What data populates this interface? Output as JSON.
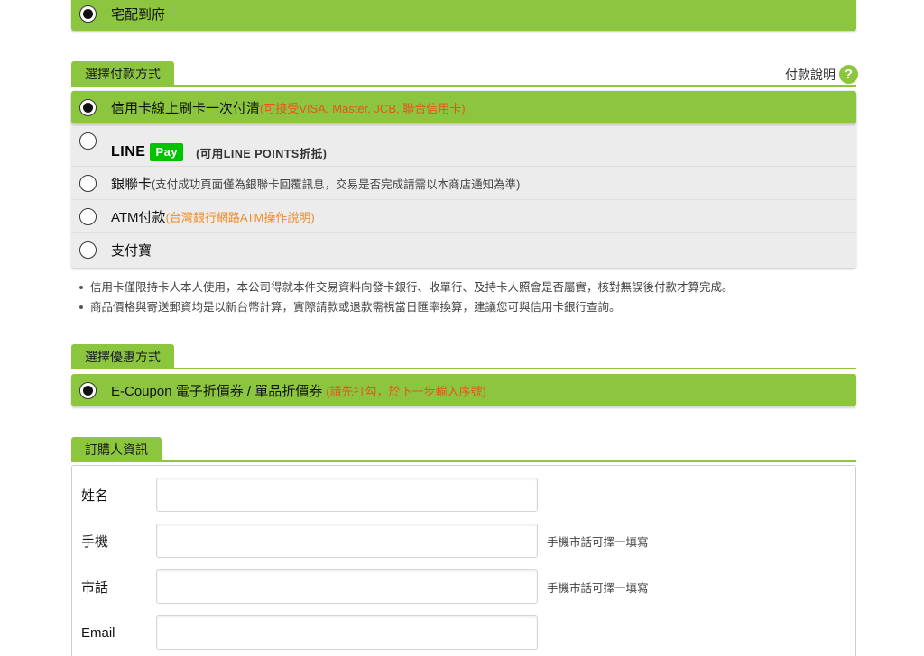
{
  "shipping": {
    "selected_label": "宅配到府"
  },
  "payment": {
    "section_title": "選擇付款方式",
    "help_label": "付款說明",
    "help_icon": "?",
    "options": [
      {
        "label": "信用卡線上刷卡一次付清",
        "note": "(可接受VISA, Master, JCB, 聯合信用卡)",
        "selected": true
      },
      {
        "logo_text": "LINE",
        "logo_badge": "Pay",
        "note": "(可用LINE POINTS折抵)",
        "selected": false
      },
      {
        "label": "銀聯卡",
        "note": "(支付成功頁面僅為銀聯卡回覆訊息，交易是否完成請需以本商店通知為準)",
        "selected": false
      },
      {
        "label": "ATM付款",
        "note": "(台灣銀行網路ATM操作說明)",
        "selected": false
      },
      {
        "label": "支付寶",
        "note": "",
        "selected": false
      }
    ],
    "notes": [
      "信用卡僅限持卡人本人使用，本公司得就本件交易資料向發卡銀行、收單行、及持卡人照會是否屬實，核對無誤後付款才算完成。",
      "商品價格與寄送郵資均是以新台幣計算，實際請款或退款需視當日匯率換算，建議您可與信用卡銀行查詢。"
    ]
  },
  "discount": {
    "section_title": "選擇優惠方式",
    "option_label": "E-Coupon 電子折價券 / 單品折價券",
    "option_note": "(請先打勾，於下一步輸入序號)",
    "selected": true
  },
  "buyer": {
    "section_title": "訂購人資訊",
    "fields": [
      {
        "label": "姓名",
        "value": "",
        "hint": ""
      },
      {
        "label": "手機",
        "value": "",
        "hint": "手機市話可擇一填寫"
      },
      {
        "label": "市話",
        "value": "",
        "hint": "手機市話可擇一填寫"
      },
      {
        "label": "Email",
        "value": "",
        "hint": ""
      }
    ]
  },
  "colors": {
    "accent_green": "#8cc63f",
    "note_orange": "#e8541c",
    "linepay_green": "#00c300"
  }
}
